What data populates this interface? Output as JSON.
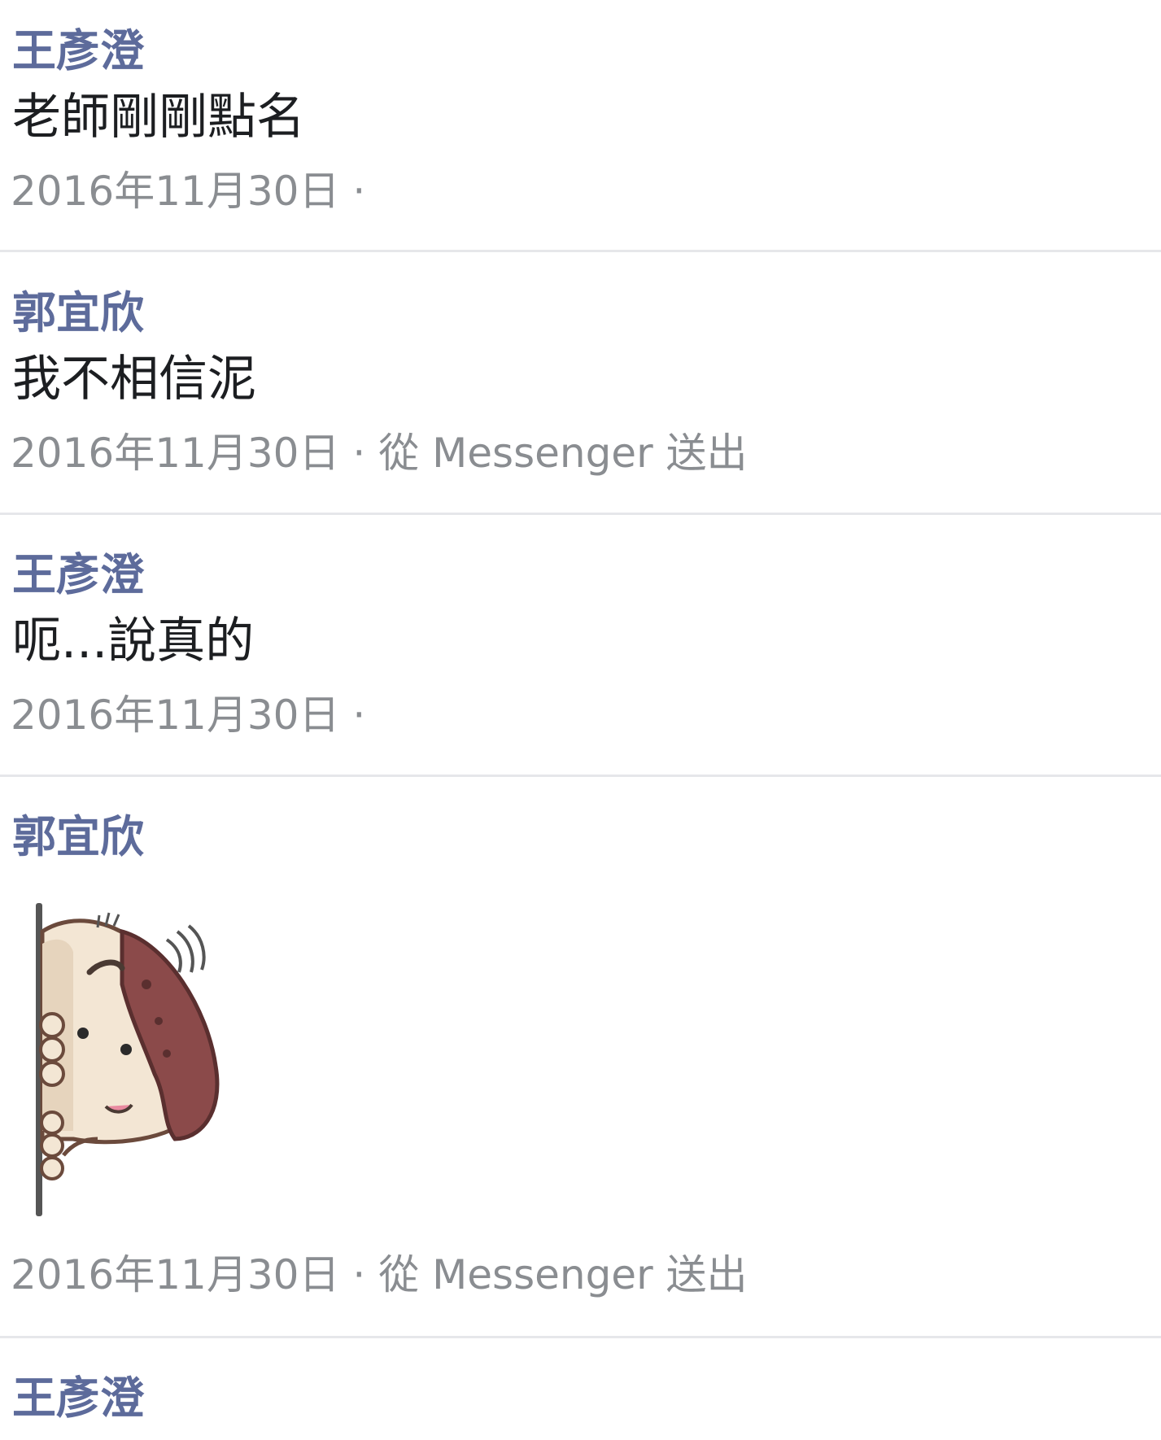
{
  "messages": [
    {
      "sender": "王彥澄",
      "text": "老師剛剛點名",
      "date": "2016年11月30日",
      "separator": "·",
      "via": ""
    },
    {
      "sender": "郭宜欣",
      "text": "我不相信泥",
      "date": "2016年11月30日",
      "separator": "·",
      "via": "從 Messenger 送出"
    },
    {
      "sender": "王彥澄",
      "text": "呃...說真的",
      "date": "2016年11月30日",
      "separator": "·",
      "via": ""
    },
    {
      "sender": "郭宜欣",
      "sticker": "peeking-character-sticker",
      "date": "2016年11月30日",
      "separator": "·",
      "via": "從 Messenger 送出"
    },
    {
      "sender": "王彥澄"
    }
  ],
  "colors": {
    "sender": "#5d6b9b",
    "text": "#1c1e21",
    "meta": "#8a8d91",
    "divider": "#e6e7ea"
  }
}
